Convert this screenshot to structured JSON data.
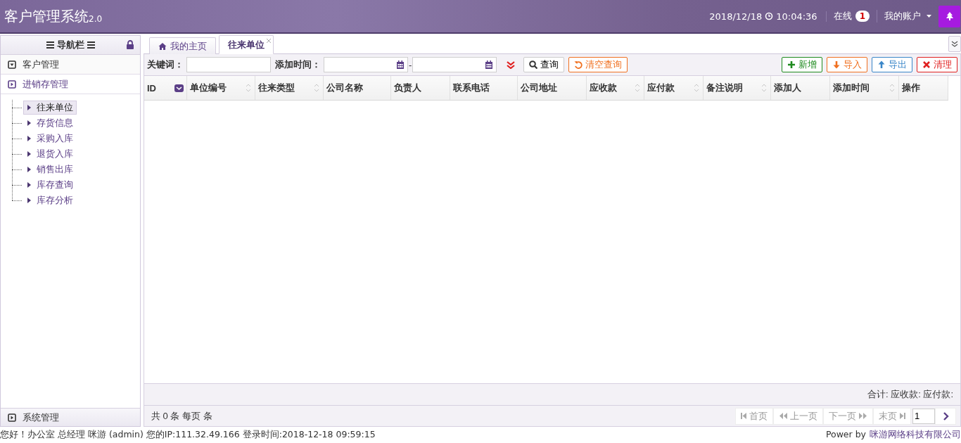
{
  "header": {
    "title": "客户管理系统",
    "version": "2.0",
    "date": "2018/12/18",
    "time": "10:04:36",
    "online_label": "在线",
    "online_count": "1",
    "account": "我的账户"
  },
  "sidebar": {
    "title": "导航栏",
    "sections": [
      {
        "label": "客户管理",
        "kind": "down",
        "selected": false
      },
      {
        "label": "进销存管理",
        "kind": "right",
        "selected": true,
        "children": [
          {
            "label": "往来单位",
            "selected": true
          },
          {
            "label": "存货信息",
            "selected": false
          },
          {
            "label": "采购入库",
            "selected": false
          },
          {
            "label": "退货入库",
            "selected": false
          },
          {
            "label": "销售出库",
            "selected": false
          },
          {
            "label": "库存查询",
            "selected": false
          },
          {
            "label": "库存分析",
            "selected": false
          }
        ]
      }
    ],
    "bottom_section": {
      "label": "系统管理",
      "kind": "right"
    }
  },
  "tabs": [
    {
      "label": "我的主页",
      "selected": false,
      "kind": "home"
    },
    {
      "label": "往来单位",
      "selected": true,
      "kind": "closable"
    }
  ],
  "toolbar": {
    "keyword_label": "关键词：",
    "date_label": "添加时间：",
    "date_separator": "-",
    "search_button": "查询",
    "clear_button": "清空查询",
    "actions": [
      {
        "label": "新增",
        "kind": "plus",
        "color": "#1e8a1e"
      },
      {
        "label": "导入",
        "kind": "down",
        "color": "#f07020"
      },
      {
        "label": "导出",
        "kind": "up",
        "color": "#3a86c8"
      },
      {
        "label": "清理",
        "kind": "cross",
        "color": "#e02020"
      }
    ]
  },
  "table": {
    "columns": [
      {
        "label": "ID",
        "sortable": false,
        "menu": true
      },
      {
        "label": "单位编号",
        "sortable": true,
        "menu": false
      },
      {
        "label": "往来类型",
        "sortable": true,
        "menu": false
      },
      {
        "label": "公司名称",
        "sortable": false,
        "menu": false
      },
      {
        "label": "负责人",
        "sortable": false,
        "menu": false
      },
      {
        "label": "联系电话",
        "sortable": false,
        "menu": false
      },
      {
        "label": "公司地址",
        "sortable": false,
        "menu": false
      },
      {
        "label": "应收款",
        "sortable": true,
        "menu": false
      },
      {
        "label": "应付款",
        "sortable": true,
        "menu": false
      },
      {
        "label": "备注说明",
        "sortable": true,
        "menu": false
      },
      {
        "label": "添加人",
        "sortable": false,
        "menu": false
      },
      {
        "label": "添加时间",
        "sortable": true,
        "menu": false
      },
      {
        "label": "操作",
        "sortable": false,
        "menu": false
      }
    ],
    "summary": "合计: 应收款: 应付款:"
  },
  "pager": {
    "info": "共 0 条 每页 条",
    "buttons": [
      {
        "label": "首页",
        "kind": "first",
        "disabled": true
      },
      {
        "label": "上一页",
        "kind": "prev",
        "disabled": true
      },
      {
        "label": "下一页",
        "kind": "next",
        "disabled": true
      },
      {
        "label": "末页",
        "kind": "last",
        "disabled": true
      }
    ],
    "page": "1"
  },
  "status_bar": {
    "user_info": "您好！办公室 总经理 咪游 (admin) 您的IP:111.32.49.166 登录时间:2018-12-18 09:59:15",
    "power_label": "Power by",
    "company_link": "咪游网络科技有限公司"
  }
}
